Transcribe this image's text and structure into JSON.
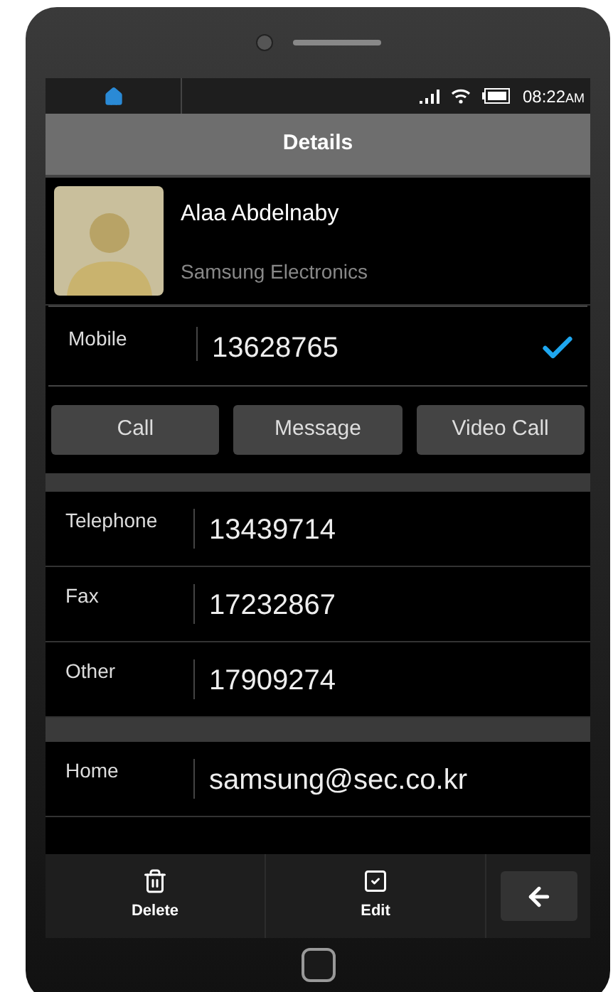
{
  "status_bar": {
    "time": "08:22",
    "meridiem": "AM"
  },
  "header": {
    "title": "Details"
  },
  "contact": {
    "name": "Alaa Abdelnaby",
    "company": "Samsung Electronics"
  },
  "primary_field": {
    "label": "Mobile",
    "value": "13628765",
    "checked": true
  },
  "actions": [
    "Call",
    "Message",
    "Video Call"
  ],
  "phone_fields": [
    {
      "label": "Telephone",
      "value": "13439714"
    },
    {
      "label": "Fax",
      "value": "17232867"
    },
    {
      "label": "Other",
      "value": "17909274"
    }
  ],
  "email_fields": [
    {
      "label": "Home",
      "value": "samsung@sec.co.kr"
    }
  ],
  "toolbar": [
    {
      "kind": "delete",
      "label": "Delete"
    },
    {
      "kind": "edit",
      "label": "Edit"
    }
  ]
}
